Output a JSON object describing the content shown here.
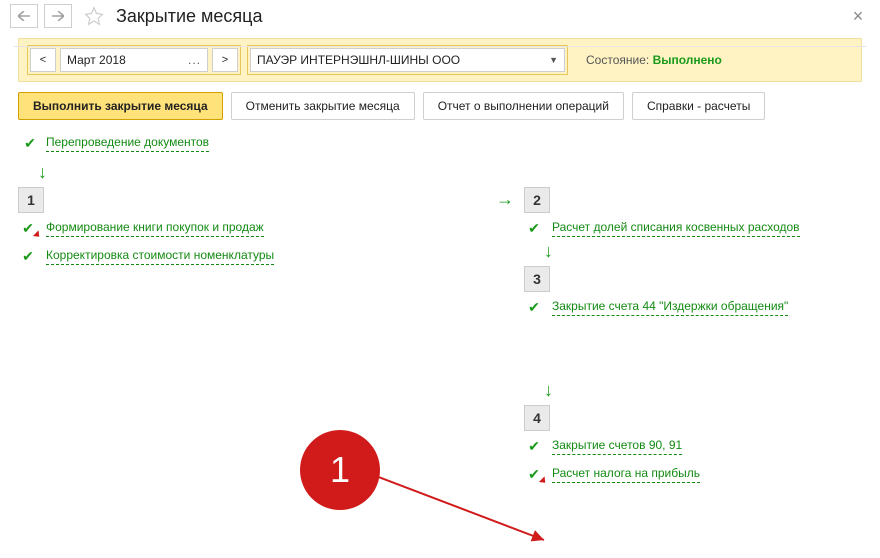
{
  "title": "Закрытие месяца",
  "period": {
    "value": "Март 2018"
  },
  "org": {
    "value": "ПАУЭР ИНТЕРНЭШНЛ-ШИНЫ ООО"
  },
  "status": {
    "label": "Состояние:",
    "value": "Выполнено"
  },
  "buttons": {
    "run": "Выполнить закрытие месяца",
    "cancel": "Отменить закрытие месяца",
    "report": "Отчет о выполнении операций",
    "calc": "Справки - расчеты"
  },
  "pre_step": {
    "label": "Перепроведение документов"
  },
  "steps": {
    "s1": {
      "num": "1",
      "items": [
        {
          "k": "form_book",
          "label": "Формирование книги покупок и продаж",
          "edited": true
        },
        {
          "k": "korr_stoim",
          "label": "Корректировка стоимости номенклатуры",
          "edited": false
        }
      ]
    },
    "s2": {
      "num": "2",
      "items": [
        {
          "k": "doley",
          "label": "Расчет долей списания косвенных расходов"
        }
      ]
    },
    "s3": {
      "num": "3",
      "items": [
        {
          "k": "close44",
          "label": "Закрытие счета 44 \"Издержки обращения\""
        }
      ]
    },
    "s4": {
      "num": "4",
      "items": [
        {
          "k": "close9091",
          "label": "Закрытие счетов 90, 91"
        },
        {
          "k": "nalog_prib",
          "label": "Расчет налога на прибыль",
          "edited": true
        }
      ]
    }
  },
  "annotation": {
    "label": "1"
  }
}
